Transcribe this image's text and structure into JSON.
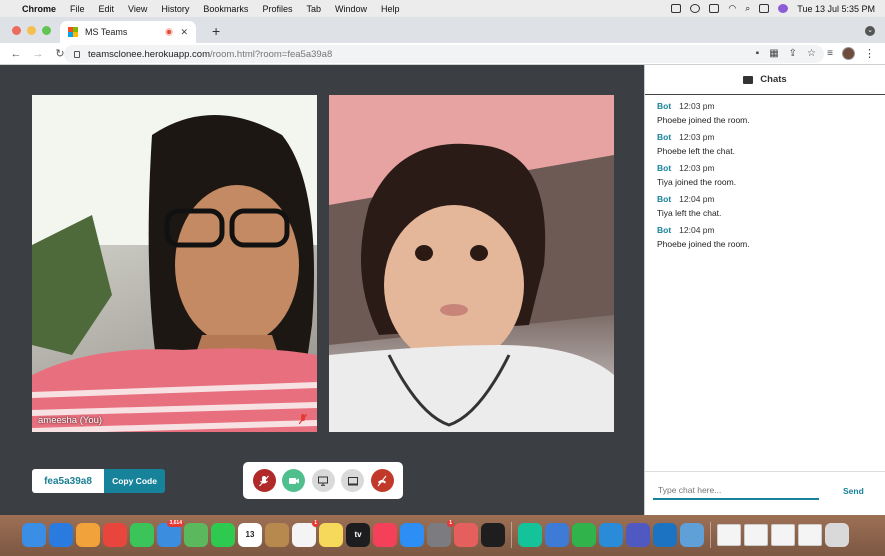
{
  "menubar": {
    "app": "Chrome",
    "items": [
      "File",
      "Edit",
      "View",
      "History",
      "Bookmarks",
      "Profiles",
      "Tab",
      "Window",
      "Help"
    ],
    "datetime": "Tue 13 Jul  5:35 PM"
  },
  "browser": {
    "tab_title": "MS Teams",
    "url_host": "teamsclonee.herokuapp.com",
    "url_path": "/room.html?room=fea5a39a8"
  },
  "room": {
    "videos": [
      {
        "label": "ameesha (You)"
      },
      {
        "label": ""
      }
    ],
    "room_code": "fea5a39a8",
    "copy_label": "Copy Code",
    "controls": [
      {
        "icon": "mic-muted-icon",
        "color": "#b02a2a"
      },
      {
        "icon": "video-camera-icon",
        "color": "#4fc08d"
      },
      {
        "icon": "screen-share-icon",
        "color": "#d9d9d9"
      },
      {
        "icon": "whiteboard-icon",
        "color": "#d9d9d9"
      },
      {
        "icon": "end-call-icon",
        "color": "#c0392b"
      }
    ]
  },
  "chat": {
    "title": "Chats",
    "messages": [
      {
        "sender": "Bot",
        "time": "12:03 pm",
        "text": "Phoebe joined the room."
      },
      {
        "sender": "Bot",
        "time": "12:03 pm",
        "text": "Phoebe left the chat."
      },
      {
        "sender": "Bot",
        "time": "12:03 pm",
        "text": "Tiya joined the room."
      },
      {
        "sender": "Bot",
        "time": "12:04 pm",
        "text": "Tiya left the chat."
      },
      {
        "sender": "Bot",
        "time": "12:04 pm",
        "text": "Phoebe joined the room."
      }
    ],
    "input_placeholder": "Type chat here...",
    "send_label": "Send"
  },
  "dock": {
    "apps": [
      {
        "name": "finder-icon",
        "color": "#3a8ee6"
      },
      {
        "name": "safari-icon",
        "color": "#2a7be0"
      },
      {
        "name": "photos-icon",
        "color": "#f2a23a"
      },
      {
        "name": "chrome-icon",
        "color": "#e8453c"
      },
      {
        "name": "messages-icon",
        "color": "#3bc45a"
      },
      {
        "name": "mail-icon",
        "color": "#3b8de0",
        "badge": "3,614"
      },
      {
        "name": "maps-icon",
        "color": "#5cb85c"
      },
      {
        "name": "facetime-icon",
        "color": "#2ec94f"
      },
      {
        "name": "calendar-icon",
        "color": "#ffffff",
        "text": "13"
      },
      {
        "name": "contacts-icon",
        "color": "#b8894f"
      },
      {
        "name": "reminders-icon",
        "color": "#f4f4f4",
        "badge": "1"
      },
      {
        "name": "notes-icon",
        "color": "#f6d85a"
      },
      {
        "name": "tv-icon",
        "color": "#1d1d1f",
        "text": "tv"
      },
      {
        "name": "music-icon",
        "color": "#f5405a"
      },
      {
        "name": "app-store-icon",
        "color": "#2d8ef5"
      },
      {
        "name": "system-preferences-icon",
        "color": "#7c7c80",
        "badge": "1"
      },
      {
        "name": "launchpad-icon",
        "color": "#e65f5f"
      },
      {
        "name": "terminal-icon",
        "color": "#1e1e1e"
      },
      {
        "name": "grammarly-icon",
        "color": "#15c39a"
      },
      {
        "name": "pen-app-icon",
        "color": "#3d7bd6"
      },
      {
        "name": "numbers-icon",
        "color": "#2fb34a"
      },
      {
        "name": "vscode-icon",
        "color": "#2a8bd8"
      },
      {
        "name": "teams-icon",
        "color": "#5058c2"
      },
      {
        "name": "vscode-insiders-icon",
        "color": "#1c73c2"
      },
      {
        "name": "preview-icon",
        "color": "#5fa0d8"
      }
    ]
  }
}
